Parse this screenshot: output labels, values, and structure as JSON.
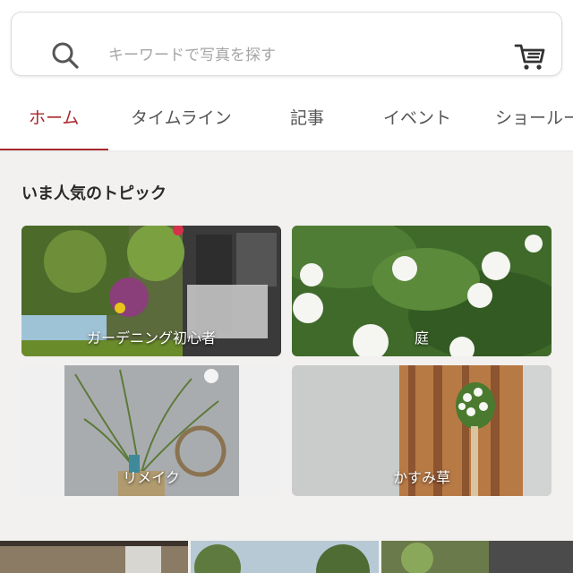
{
  "search": {
    "placeholder": "キーワードで写真を探す",
    "value": ""
  },
  "tabs": [
    {
      "label": "ホーム",
      "active": true
    },
    {
      "label": "タイムライン",
      "active": false
    },
    {
      "label": "記事",
      "active": false
    },
    {
      "label": "イベント",
      "active": false
    },
    {
      "label": "ショールー",
      "active": false
    }
  ],
  "section": {
    "title": "いま人気のトピック"
  },
  "topics": [
    {
      "label": "ガーデニング初心者"
    },
    {
      "label": "庭"
    },
    {
      "label": "リメイク"
    },
    {
      "label": "かすみ草"
    }
  ],
  "colors": {
    "accent": "#a8292c",
    "icon": "#444444",
    "placeholder": "#a5a5a5"
  },
  "icons": {
    "search": "search-icon",
    "cart": "cart-icon"
  }
}
